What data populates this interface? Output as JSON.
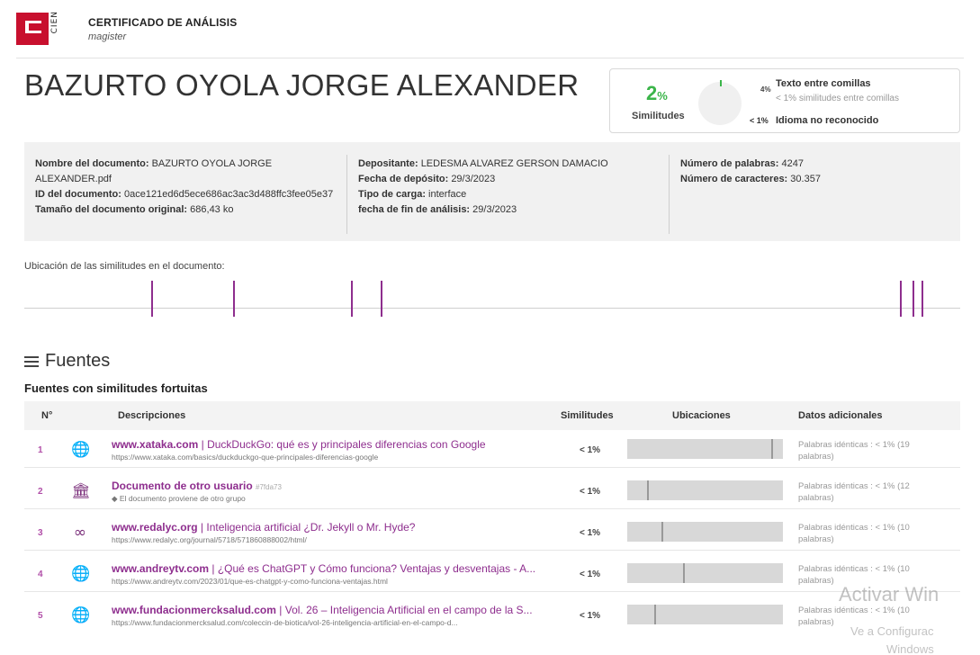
{
  "header": {
    "logo_text": "CIEN",
    "title": "CERTIFICADO DE ANÁLISIS",
    "subtitle": "magister"
  },
  "author": "BAZURTO OYOLA JORGE ALEXANDER",
  "similarity": {
    "percent": "2",
    "percent_sign": "%",
    "label": "Similitudes",
    "quoted_pct": "4%",
    "quoted_title": "Texto entre comillas",
    "quoted_sub": "< 1% similitudes entre comillas",
    "lang_pct": "< 1%",
    "lang_title": "Idioma no reconocido",
    "colors": {
      "accent": "#3bb54a",
      "brand": "#c8102e",
      "source": "#8e2e8e"
    }
  },
  "info": {
    "doc_name_label": "Nombre del documento:",
    "doc_name": "BAZURTO OYOLA JORGE ALEXANDER.pdf",
    "doc_id_label": "ID del documento:",
    "doc_id": "0ace121ed6d5ece686ac3ac3d488ffc3fee05e37",
    "size_label": "Tamaño del documento original:",
    "size": "686,43 ko",
    "depositor_label": "Depositante:",
    "depositor": "LEDESMA ALVAREZ GERSON DAMACIO",
    "deposit_date_label": "Fecha de depósito:",
    "deposit_date": "29/3/2023",
    "upload_type_label": "Tipo de carga:",
    "upload_type": "interface",
    "end_date_label": "fecha de fin de análisis:",
    "end_date": "29/3/2023",
    "words_label": "Número de palabras:",
    "words": "4247",
    "chars_label": "Número de caracteres:",
    "chars": "30.357"
  },
  "location": {
    "label": "Ubicación de las similitudes en el documento:"
  },
  "sources": {
    "heading": "Fuentes",
    "subheading": "Fuentes con similitudes fortuitas",
    "columns": [
      "N°",
      "Descripciones",
      "Similitudes",
      "Ubicaciones",
      "Datos adicionales"
    ],
    "rows": [
      {
        "n": "1",
        "icon": "globe-icon",
        "site": "www.xataka.com",
        "desc": "DuckDuckGo: qué es y principales diferencias con Google",
        "url": "https://www.xataka.com/basics/duckduckgo-que-principales-diferencias-google",
        "sim": "< 1%",
        "data": "Palabras idénticas : < 1% (19 palabras)"
      },
      {
        "n": "2",
        "icon": "institution-icon",
        "site": "Documento de otro usuario",
        "desc": "#7fda73",
        "url": "El documento proviene de otro grupo",
        "sim": "< 1%",
        "data": "Palabras idénticas : < 1% (12 palabras)"
      },
      {
        "n": "3",
        "icon": "link-icon",
        "site": "www.redalyc.org",
        "desc": "Inteligencia artificial ¿Dr. Jekyll o Mr. Hyde?",
        "url": "https://www.redalyc.org/journal/5718/571860888002/html/",
        "sim": "< 1%",
        "data": "Palabras idénticas : < 1% (10 palabras)"
      },
      {
        "n": "4",
        "icon": "globe-icon",
        "site": "www.andreytv.com",
        "desc": "¿Qué es ChatGPT y Cómo funciona? Ventajas y desventajas - A...",
        "url": "https://www.andreytv.com/2023/01/que-es-chatgpt-y-como-funciona-ventajas.html",
        "sim": "< 1%",
        "data": "Palabras idénticas : < 1% (10 palabras)"
      },
      {
        "n": "5",
        "icon": "globe-icon",
        "site": "www.fundacionmercksalud.com",
        "desc": "Vol. 26 – Inteligencia Artificial en el campo de la S...",
        "url": "https://www.fundacionmercksalud.com/coleccin-de-biotica/vol-26-inteligencia-artificial-en-el-campo-d...",
        "sim": "< 1%",
        "data": "Palabras idénticas : < 1% (10 palabras)"
      }
    ]
  },
  "watermark": {
    "line1": "Activar Win",
    "line2": "Ve a Configurac",
    "line3": "Windows"
  }
}
